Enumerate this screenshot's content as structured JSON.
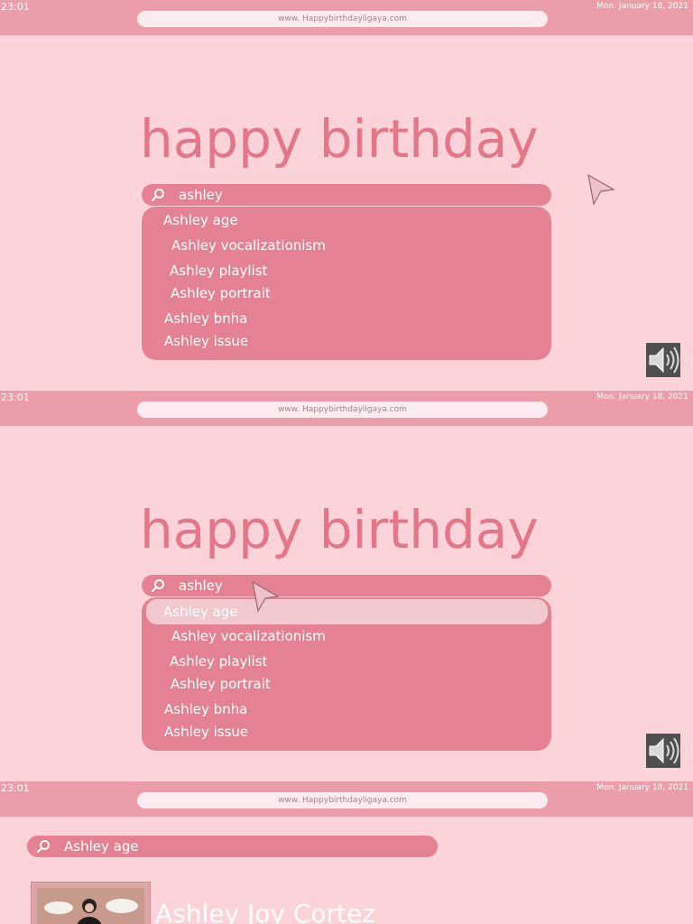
{
  "status": {
    "time": "23:01",
    "date": "Mon. January 18, 2021",
    "url": "www. Happybirthdayligaya.com"
  },
  "home": {
    "title": "happy birthday",
    "query": "ashley",
    "suggestions": [
      "Ashley age",
      "Ashley vocalizationism",
      "Ashley playlist",
      "Ashley portrait",
      "Ashley bnha",
      "Ashley issue"
    ],
    "highlighted_index": 0
  },
  "results": {
    "query": "Ashley age",
    "name": "Ashley Joy Cortez"
  },
  "icons": {
    "search": "magnifier-icon",
    "speaker": "speaker-icon",
    "cursor": "cursor-icon"
  },
  "colors": {
    "page_bg": "#fdd3da",
    "topbar": "#eb9ea9",
    "accent": "#e37689",
    "search_bg": "#e48294",
    "highlight": "#f0c8ce"
  }
}
